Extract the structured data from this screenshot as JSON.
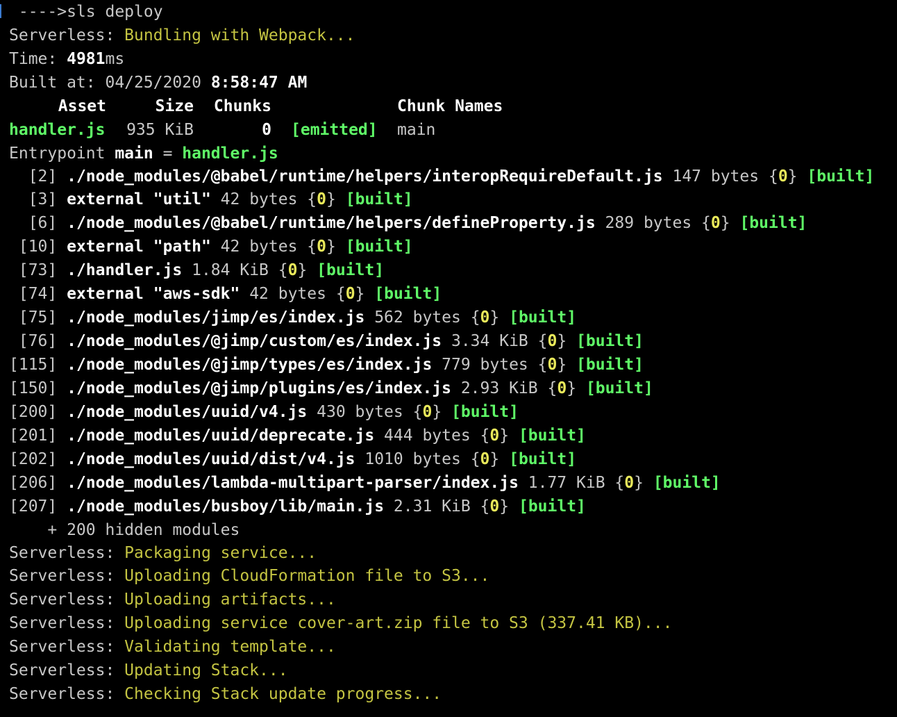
{
  "terminal": {
    "prompt": " ---->",
    "command": "sls deploy",
    "bundling": {
      "prefix": "Serverless: ",
      "msg": "Bundling with Webpack..."
    },
    "time": {
      "label": "Time: ",
      "value": "4981",
      "unit": "ms"
    },
    "built_at": {
      "label": "Built at: ",
      "date": "04/25/2020",
      "time": "8:58:47 AM"
    },
    "table_header": {
      "asset": "Asset",
      "size": "Size",
      "chunks": "Chunks",
      "chunk_names": "Chunk Names"
    },
    "asset_row": {
      "asset": "handler.js",
      "size": "935 KiB",
      "chunks": "0",
      "status": "[emitted]",
      "name": "main"
    },
    "entrypoint": {
      "label": "Entrypoint ",
      "name": "main",
      "eq": " = ",
      "file": "handler.js"
    },
    "modules": [
      {
        "id": "  [2] ",
        "path": "./node_modules/@babel/runtime/helpers/interopRequireDefault.js",
        "size": "147 bytes",
        "chunk": "0"
      },
      {
        "id": "  [3] ",
        "path": "external \"util\"",
        "size": "42 bytes",
        "chunk": "0"
      },
      {
        "id": "  [6] ",
        "path": "./node_modules/@babel/runtime/helpers/defineProperty.js",
        "size": "289 bytes",
        "chunk": "0"
      },
      {
        "id": " [10] ",
        "path": "external \"path\"",
        "size": "42 bytes",
        "chunk": "0"
      },
      {
        "id": " [73] ",
        "path": "./handler.js",
        "size": "1.84 KiB",
        "chunk": "0"
      },
      {
        "id": " [74] ",
        "path": "external \"aws-sdk\"",
        "size": "42 bytes",
        "chunk": "0"
      },
      {
        "id": " [75] ",
        "path": "./node_modules/jimp/es/index.js",
        "size": "562 bytes",
        "chunk": "0"
      },
      {
        "id": " [76] ",
        "path": "./node_modules/@jimp/custom/es/index.js",
        "size": "3.34 KiB",
        "chunk": "0"
      },
      {
        "id": "[115] ",
        "path": "./node_modules/@jimp/types/es/index.js",
        "size": "779 bytes",
        "chunk": "0"
      },
      {
        "id": "[150] ",
        "path": "./node_modules/@jimp/plugins/es/index.js",
        "size": "2.93 KiB",
        "chunk": "0"
      },
      {
        "id": "[200] ",
        "path": "./node_modules/uuid/v4.js",
        "size": "430 bytes",
        "chunk": "0"
      },
      {
        "id": "[201] ",
        "path": "./node_modules/uuid/deprecate.js",
        "size": "444 bytes",
        "chunk": "0"
      },
      {
        "id": "[202] ",
        "path": "./node_modules/uuid/dist/v4.js",
        "size": "1010 bytes",
        "chunk": "0"
      },
      {
        "id": "[206] ",
        "path": "./node_modules/lambda-multipart-parser/index.js",
        "size": "1.77 KiB",
        "chunk": "0"
      },
      {
        "id": "[207] ",
        "path": "./node_modules/busboy/lib/main.js",
        "size": "2.31 KiB",
        "chunk": "0"
      }
    ],
    "built_label": "[built]",
    "hidden": "    + 200 hidden modules",
    "serverless_msgs": [
      {
        "prefix": "Serverless: ",
        "msg": "Packaging service..."
      },
      {
        "prefix": "Serverless: ",
        "msg": "Uploading CloudFormation file to S3..."
      },
      {
        "prefix": "Serverless: ",
        "msg": "Uploading artifacts..."
      },
      {
        "prefix": "Serverless: ",
        "msg": "Uploading service cover-art.zip file to S3 (337.41 KB)..."
      },
      {
        "prefix": "Serverless: ",
        "msg": "Validating template..."
      },
      {
        "prefix": "Serverless: ",
        "msg": "Updating Stack..."
      },
      {
        "prefix": "Serverless: ",
        "msg": "Checking Stack update progress..."
      }
    ]
  }
}
